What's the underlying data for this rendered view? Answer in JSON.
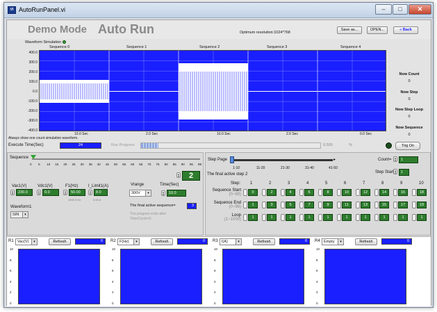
{
  "window": {
    "title": "AutoRunPanel.vi",
    "min": "–",
    "max": "□",
    "close": "✕"
  },
  "header": {
    "mode": "Demo Mode",
    "title": "Auto Run",
    "resolution": "Optimum resolution:1024*768",
    "save_as": "Save as...",
    "open": "OPEN...",
    "back": "Back",
    "back_icon": "«"
  },
  "simulation": {
    "label": "Waveform Simulation",
    "y_ticks": [
      "400.0",
      "300.0",
      "200.0",
      "100.0",
      "0.0",
      "-100.0",
      "-200.0",
      "-300.0",
      "-400.0"
    ],
    "sequences": [
      "Sequence 0",
      "Sequence 1",
      "Sequence 2",
      "Sequence 3",
      "Sequence 4"
    ],
    "times": [
      "10.0 Sec",
      "2.0 Sec",
      "10.0 Sec",
      "2.0 Sec",
      "0.0 Sec"
    ],
    "note": "Always show one count simulation waveform.",
    "plot_bg": "#1a1fff",
    "wave_color": "#ffffff"
  },
  "status": {
    "now_count_label": "Now Count",
    "now_count": "0",
    "now_step_label": "Now Step",
    "now_step": "0",
    "now_step_loop_label": "Now Step Loop",
    "now_step_loop": "0",
    "now_sequence_label": "Now Sequence",
    "now_sequence": "0"
  },
  "exec": {
    "label": "Execute Time(Sec)",
    "value": "24",
    "progress_label": "Run Progress",
    "progress_value": "9.500",
    "progress_unit": "%",
    "progress_fraction": 0.095,
    "trig_on": "Trig On"
  },
  "sequence": {
    "label": "Sequence",
    "ticks": [
      "0",
      "5",
      "10",
      "15",
      "20",
      "25",
      "30",
      "35",
      "40",
      "45",
      "50",
      "55",
      "60",
      "65",
      "70",
      "75",
      "80",
      "85",
      "90",
      "95",
      "99"
    ],
    "sel_value": "2"
  },
  "params": {
    "vac_label": "Vac1(V)",
    "vac": "230.0",
    "vdc_label": "Vdc1(V)",
    "vdc": "0.0",
    "f_label": "F1(Hz)",
    "f": "50.00",
    "f_range": "1000.0 Hz",
    "ilimit_label": "I_Limit1(A)",
    "ilimit": "8.0",
    "ilimit_range": "0.00  A",
    "vrange_label": "Vrange",
    "vrange": "300V",
    "time_label": "Time(Sec)",
    "time": "10.0",
    "waveform_label": "Waveform1",
    "waveform": "SIN",
    "final_active_seq": "The final active sequence=",
    "final_active_seq_val": "3",
    "program_note": "The program ends after Time/Cycle=0"
  },
  "steps": {
    "page_label": "Step Page",
    "page_ticks": [
      "1-10",
      "11-20",
      "21-30",
      "31-40",
      "41-50"
    ],
    "count_label": "Count=",
    "count": "1",
    "step_start_label": "Step Start",
    "step_start": "1",
    "final_step": "The final active step  2",
    "step_label": "Step:",
    "step_numbers": [
      "1",
      "2",
      "3",
      "4",
      "5",
      "6",
      "7",
      "8",
      "9",
      "10"
    ],
    "seq_start_label": "Sequence Start",
    "seq_start_range": "(0~99)",
    "seq_start": [
      "0",
      "2",
      "4",
      "6",
      "8",
      "10",
      "12",
      "14",
      "16",
      "18"
    ],
    "seq_end_label": "Sequence End",
    "seq_end_range": "(0~99)",
    "seq_end": [
      "1",
      "3",
      "5",
      "7",
      "9",
      "11",
      "13",
      "15",
      "17",
      "19"
    ],
    "loop_label": "Loop",
    "loop_range": "(1~1000)",
    "loop": [
      "1",
      "1",
      "1",
      "1",
      "1",
      "1",
      "1",
      "1",
      "1",
      "1"
    ]
  },
  "readouts": [
    {
      "tag": "R1",
      "select": "Vac(V)",
      "refresh": "Refresh",
      "value": "0"
    },
    {
      "tag": "R2",
      "select": "F(Hz)",
      "refresh": "Refresh",
      "value": "0"
    },
    {
      "tag": "R3",
      "select": "I(A)",
      "refresh": "Refresh",
      "value": "0"
    },
    {
      "tag": "R4",
      "select": "Empty",
      "refresh": "Refresh",
      "value": "0"
    }
  ],
  "mini_ticks": [
    "10",
    "8",
    "6",
    "4",
    "2",
    "0"
  ]
}
